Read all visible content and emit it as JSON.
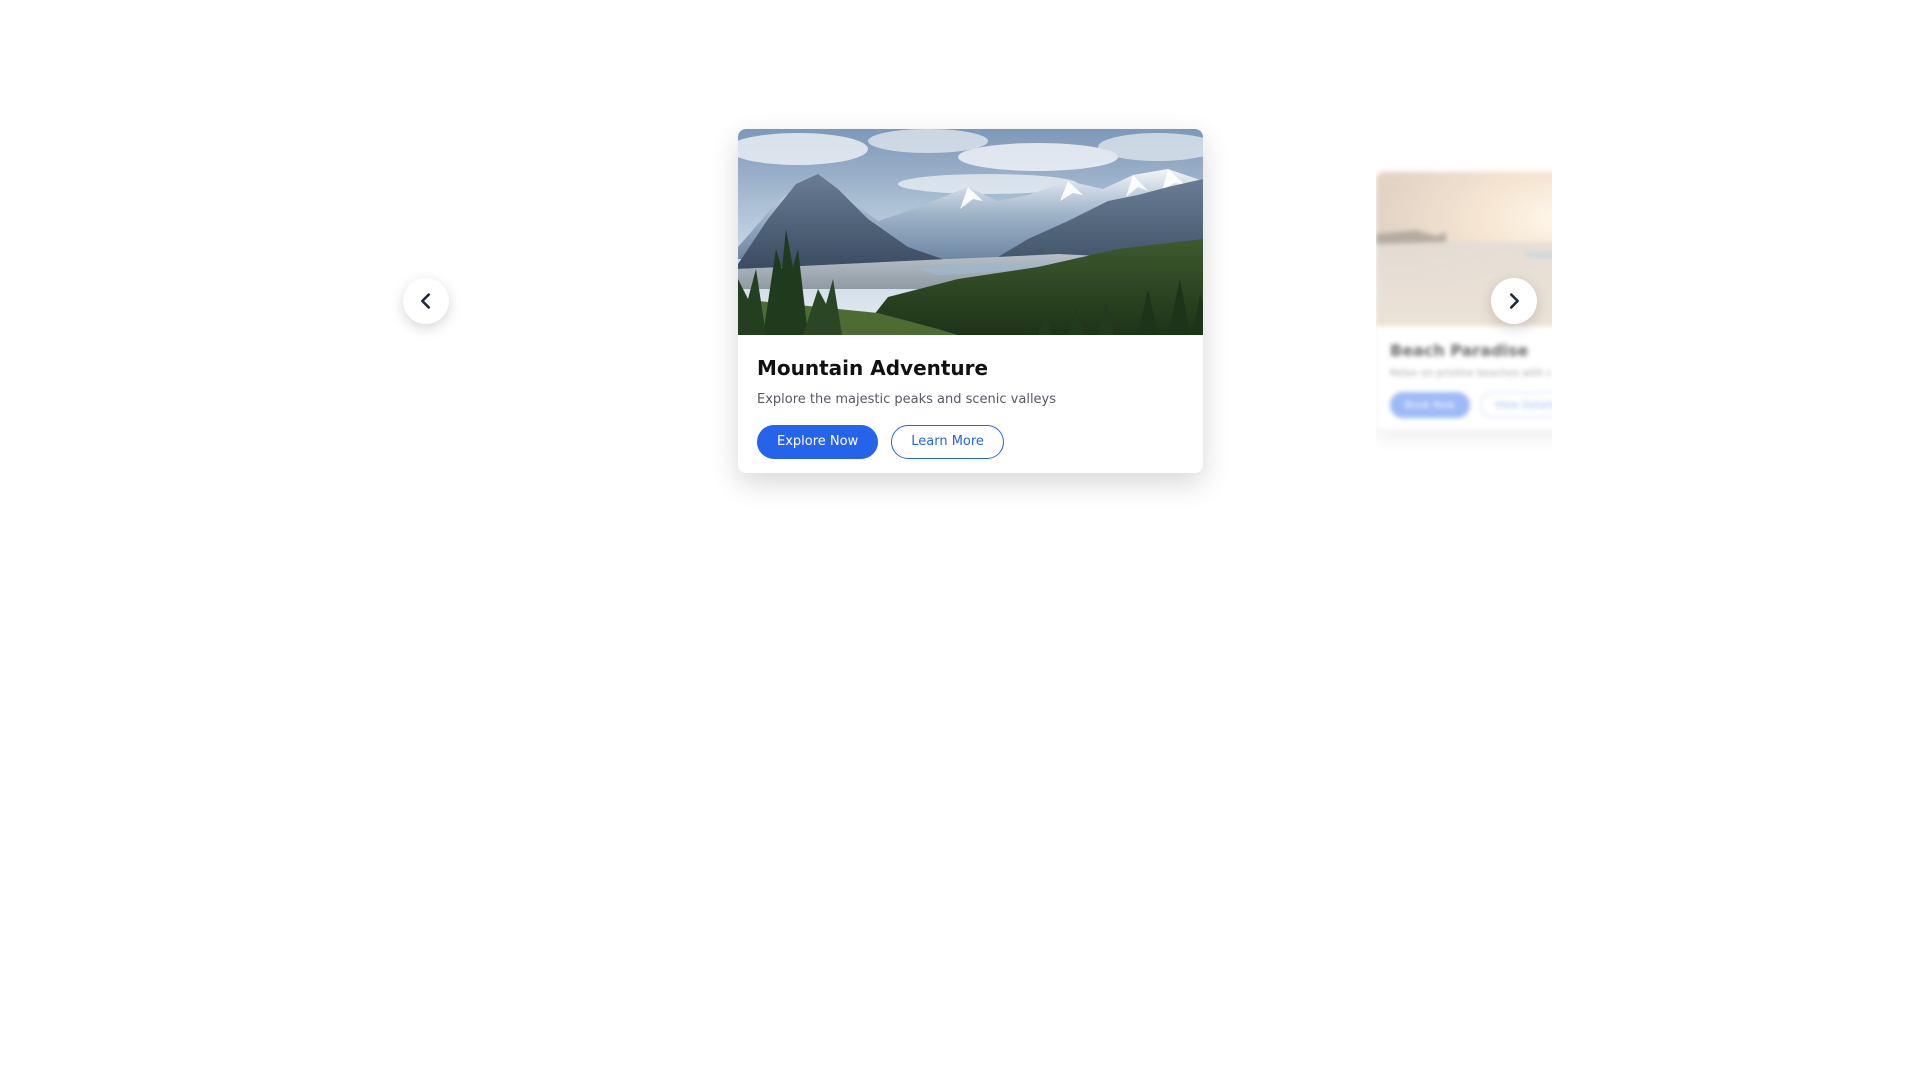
{
  "carousel": {
    "prev_icon": "chevron-left-icon",
    "next_icon": "chevron-right-icon",
    "cards": [
      {
        "title": "Mountain Adventure",
        "description": "Explore the majestic peaks and scenic valleys",
        "primary_label": "Explore Now",
        "secondary_label": "Learn More",
        "image": "mountain-landscape-image"
      },
      {
        "title": "Beach Paradise",
        "description": "Relax on pristine beaches with c",
        "primary_label": "Book Now",
        "secondary_label": "View Details",
        "image": "beach-sunset-image"
      }
    ]
  },
  "colors": {
    "accent": "#2563eb",
    "background": "#ffffff",
    "title_text": "#111111",
    "body_text": "#555a63"
  }
}
